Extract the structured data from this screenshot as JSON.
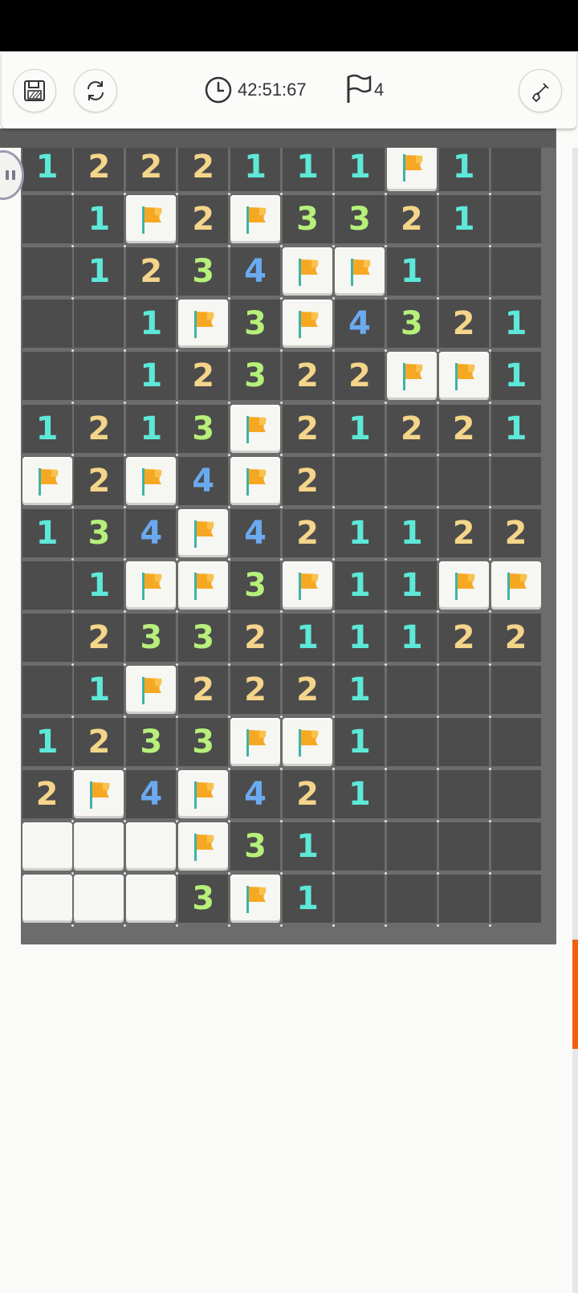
{
  "toolbar": {
    "timer": "42:51:67",
    "flags_remaining": "4",
    "save_icon": "save-icon",
    "restart_icon": "restart-icon",
    "clock_icon": "clock-icon",
    "flag_icon": "flag-outline-icon",
    "shovel_icon": "shovel-icon"
  },
  "board": {
    "columns": 10,
    "visible_rows": 15,
    "number_colors": {
      "1": "#5de8d8",
      "2": "#f4d58a",
      "3": "#b6f07a",
      "4": "#6aaaf0"
    },
    "flag_color": "#f7a823",
    "rows": [
      [
        "1",
        "2",
        "2",
        "2",
        "1",
        "1",
        "1",
        "F",
        "1",
        "."
      ],
      [
        ".",
        "1",
        "F",
        "2",
        "F",
        "3",
        "3",
        "2",
        "1",
        "."
      ],
      [
        ".",
        "1",
        "2",
        "3",
        "4",
        "F",
        "F",
        "1",
        ".",
        "."
      ],
      [
        ".",
        ".",
        "1",
        "F",
        "3",
        "F",
        "4",
        "3",
        "2",
        "1"
      ],
      [
        ".",
        ".",
        "1",
        "2",
        "3",
        "2",
        "2",
        "F",
        "F",
        "1"
      ],
      [
        "1",
        "2",
        "1",
        "3",
        "F",
        "2",
        "1",
        "2",
        "2",
        "1"
      ],
      [
        "F",
        "2",
        "F",
        "4",
        "F",
        "2",
        ".",
        ".",
        ".",
        "."
      ],
      [
        "1",
        "3",
        "4",
        "F",
        "4",
        "2",
        "1",
        "1",
        "2",
        "2"
      ],
      [
        ".",
        "1",
        "F",
        "F",
        "3",
        "F",
        "1",
        "1",
        "F",
        "F"
      ],
      [
        ".",
        "2",
        "3",
        "3",
        "2",
        "1",
        "1",
        "1",
        "2",
        "2"
      ],
      [
        ".",
        "1",
        "F",
        "2",
        "2",
        "2",
        "1",
        ".",
        ".",
        "."
      ],
      [
        "1",
        "2",
        "3",
        "3",
        "F",
        "F",
        "1",
        ".",
        ".",
        "."
      ],
      [
        "2",
        "F",
        "4",
        "F",
        "4",
        "2",
        "1",
        ".",
        ".",
        "."
      ],
      [
        "H",
        "H",
        "H",
        "F",
        "3",
        "1",
        ".",
        ".",
        ".",
        "."
      ],
      [
        "H",
        "H",
        "H",
        "3",
        "F",
        "1",
        ".",
        ".",
        ".",
        "."
      ]
    ]
  }
}
